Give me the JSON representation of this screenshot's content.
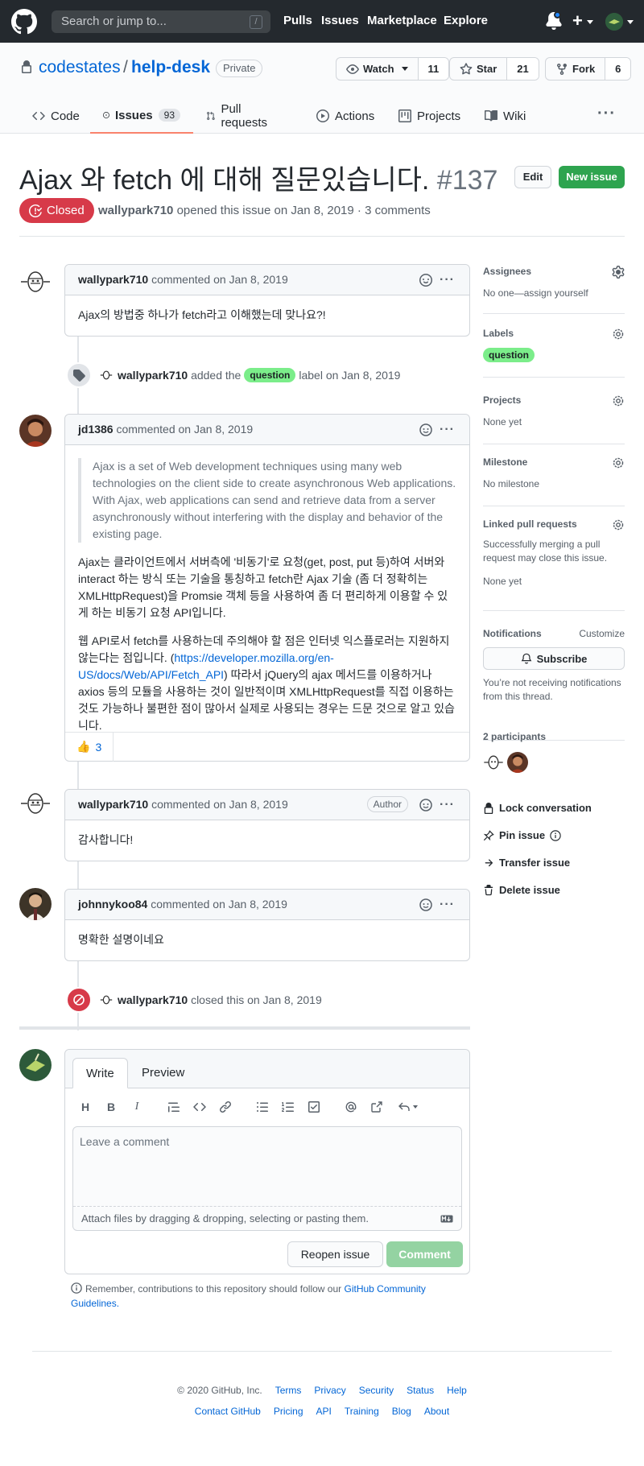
{
  "header": {
    "search_placeholder": "Search or jump to...",
    "search_shortcut": "/",
    "nav": [
      "Pulls",
      "Issues",
      "Marketplace",
      "Explore"
    ]
  },
  "repo": {
    "owner": "codestates",
    "separator": "/",
    "name": "help-desk",
    "visibility": "Private",
    "watch_label": "Watch",
    "watch_count": "11",
    "star_label": "Star",
    "star_count": "21",
    "fork_label": "Fork",
    "fork_count": "6"
  },
  "tabs": [
    {
      "label": "Code"
    },
    {
      "label": "Issues",
      "count": "93"
    },
    {
      "label": "Pull requests"
    },
    {
      "label": "Actions"
    },
    {
      "label": "Projects"
    },
    {
      "label": "Wiki"
    }
  ],
  "issue": {
    "title": "Ajax 와 fetch 에 대해 질문있습니다.",
    "number": "#137",
    "edit_label": "Edit",
    "new_issue_label": "New issue",
    "state": "Closed",
    "author": "wallypark710",
    "opened_text": "opened this issue on Jan 8, 2019 · 3 comments"
  },
  "comments": [
    {
      "author": "wallypark710",
      "meta": "commented on Jan 8, 2019",
      "body": "Ajax의 방법중 하나가 fetch라고 이해했는데 맞나요?!"
    },
    {
      "author": "jd1386",
      "meta": "commented on Jan 8, 2019",
      "quote": "Ajax is a set of Web development techniques using many web technologies on the client side to create asynchronous Web applications. With Ajax, web applications can send and retrieve data from a server asynchronously without interfering with the display and behavior of the existing page.",
      "para1": "Ajax는 클라이언트에서 서버측에 '비동기'로 요청(get, post, put 등)하여 서버와 interact 하는 방식 또는 기술을 통칭하고 fetch란 Ajax 기술 (좀 더 정확히는 XMLHttpRequest)을 Promsie 객체 등을 사용하여 좀 더 편리하게 이용할 수 있게 하는 비동기 요청 API입니다.",
      "para2_a": "웹 API로서 fetch를 사용하는데 주의해야 할 점은 인터넷 익스플로러는 지원하지 않는다는 점입니다. (",
      "para2_link": "https://developer.mozilla.org/en-US/docs/Web/API/Fetch_API",
      "para2_b": ") 따라서 jQuery의 ajax 메서드를 이용하거나 axios 등의 모듈을 사용하는 것이 일반적이며 XMLHttpRequest를 직접 이용하는 것도 가능하나 불편한 점이 많아서 실제로 사용되는 경우는 드문 것으로 알고 있습니다.",
      "reaction_emoji": "👍",
      "reaction_count": "3"
    },
    {
      "author": "wallypark710",
      "meta": "commented on Jan 8, 2019",
      "badge": "Author",
      "body": "감사합니다!"
    },
    {
      "author": "johnnykoo84",
      "meta": "commented on Jan 8, 2019",
      "body": "명확한 설명이네요"
    }
  ],
  "events": {
    "label_event": {
      "actor": "wallypark710",
      "text_before": "added the",
      "label": "question",
      "text_after": "label on Jan 8, 2019"
    },
    "closed_event": {
      "actor": "wallypark710",
      "text": "closed this on Jan 8, 2019"
    }
  },
  "new_comment": {
    "tab_write": "Write",
    "tab_preview": "Preview",
    "toolbar": [
      "heading-icon",
      "bold-icon",
      "italic-icon",
      "quote-icon",
      "code-icon",
      "link-icon",
      "unordered-list-icon",
      "ordered-list-icon",
      "task-list-icon",
      "mention-icon",
      "cross-reference-icon",
      "reply-icon"
    ],
    "placeholder": "Leave a comment",
    "attach_text": "Attach files by dragging & dropping, selecting or pasting them.",
    "reopen_label": "Reopen issue",
    "comment_label": "Comment",
    "remember_text": "Remember, contributions to this repository should follow our",
    "remember_link": "GitHub Community Guidelines."
  },
  "sidebar": {
    "assignees_title": "Assignees",
    "assignees_value": "No one—assign yourself",
    "labels_title": "Labels",
    "label_value": "question",
    "projects_title": "Projects",
    "projects_value": "None yet",
    "milestone_title": "Milestone",
    "milestone_value": "No milestone",
    "linked_title": "Linked pull requests",
    "linked_desc": "Successfully merging a pull request may close this issue.",
    "linked_value": "None yet",
    "notifications_title": "Notifications",
    "customize_label": "Customize",
    "subscribe_label": "Subscribe",
    "notifications_desc": "You’re not receiving notifications from this thread.",
    "participants_title": "2 participants",
    "lock_label": "Lock conversation",
    "pin_label": "Pin issue",
    "transfer_label": "Transfer issue",
    "delete_label": "Delete issue"
  },
  "footer": {
    "copyright": "© 2020 GitHub, Inc.",
    "row1": [
      "Terms",
      "Privacy",
      "Security",
      "Status",
      "Help"
    ],
    "row2": [
      "Contact GitHub",
      "Pricing",
      "API",
      "Training",
      "Blog",
      "About"
    ]
  },
  "colors": {
    "header_bg": "#24292e",
    "closed_red": "#d73a49",
    "primary_green": "#2ea44f",
    "link_blue": "#0366d6",
    "label_green": "#7bed8a",
    "active_tab_underline": "#f9826c"
  }
}
